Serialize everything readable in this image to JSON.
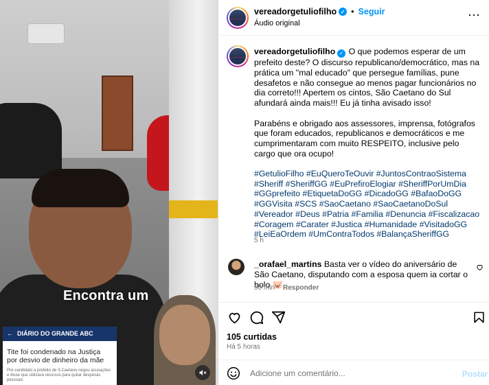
{
  "media": {
    "caption": "Encontra um",
    "news": {
      "masthead": "DIÁRIO DO GRANDE ABC",
      "headline": "Tite foi condenado na Justiça por desvio de dinheiro da mãe",
      "body": "Pré-candidato a prefeito de S.Caetano negou acusações e disse que utilizava recursos para quitar despesas pessoais"
    }
  },
  "header": {
    "username": "vereadorgetuliofilho",
    "separator": "•",
    "follow_label": "Seguir",
    "audio": "Áudio original",
    "more_icon": "more-horizontal-icon"
  },
  "post": {
    "username": "vereadorgetuliofilho",
    "text": " O que podemos esperar de um prefeito deste? O discurso republicano/democrático, mas na prática um \"mal educado\" que persegue famílias, pune desafetos e não consegue ao menos pagar funcionários no dia correto!!! Apertem os cintos, São Caetano do Sul afundará ainda mais!!! Eu já tinha avisado isso!\n\nParabéns e obrigado aos assessores, imprensa, fotógrafos que foram educados, republicanos e democráticos e me cumprimentaram com muito RESPEITO, inclusive pelo cargo que ora ocupo!\n\n",
    "hashtags": "#GetulioFilho #EuQueroTeOuvir #JuntosContraoSistema #Sheriff #SheriffGG #EuPrefiroElogiar #SheriffPorUmDia #GGprefeito #EtiquetaDoGG #DicadoGG #BafaoDoGG #GGVisita #SCS #SaoCaetano #SaoCaetanoDoSul #Vereador #Deus #Patria #Familia #Denuncia #Fiscalizacao #Coragem #Carater #Justica #Humanidade #VisitadoGG #LeiEaOrdem #UmContraTodos #BalançaSheriffGG",
    "time": "5 h"
  },
  "comment": {
    "username": "_orafael_martins",
    "text": " Basta ver o vídeo do aniversário de São Caetano, disputando com a esposa quem ia cortar o bolo 🐷",
    "time": "50 min",
    "reply_label": "Responder"
  },
  "actions": {
    "likes": "105 curtidas",
    "ago": "Há 5 horas"
  },
  "add_comment": {
    "placeholder": "Adicione um comentário...",
    "post_label": "Postar"
  },
  "colors": {
    "accent": "#0095f6",
    "hashtag": "#00376b",
    "muted": "#737373"
  }
}
